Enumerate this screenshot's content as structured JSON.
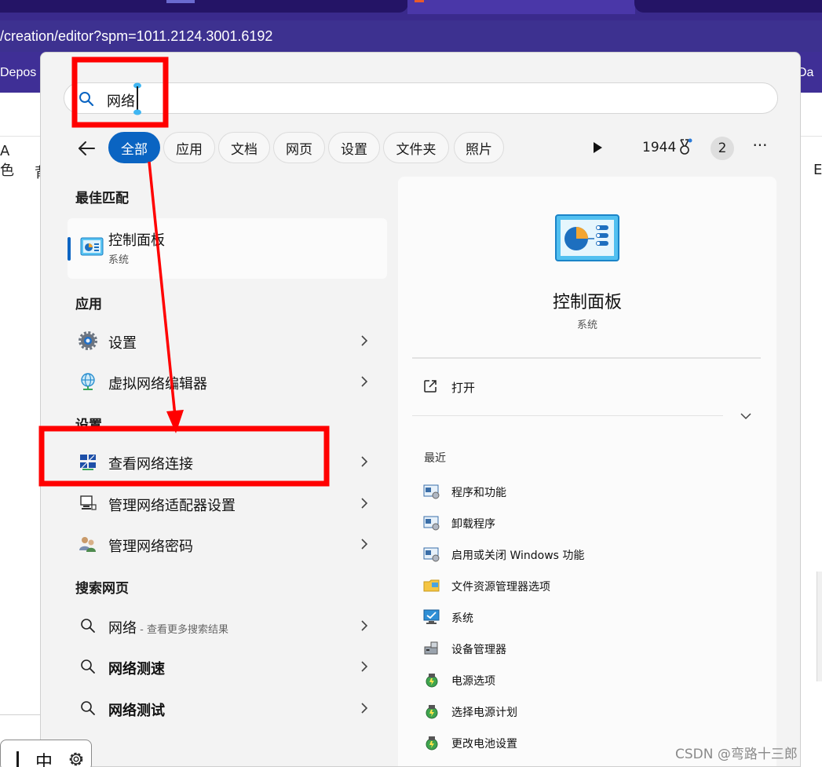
{
  "browser": {
    "url": "/creation/editor?spm=1011.2124.3001.6192",
    "bookmark_left": "Depos",
    "bookmark_right": "Da",
    "left_chars_line1": "A",
    "left_chars_line2": "色",
    "left_char_2": "背",
    "right_char": "E"
  },
  "ime": {
    "mode": "中",
    "settings_icon": "gear-icon"
  },
  "search": {
    "value": "网络",
    "icon": "search-icon"
  },
  "filters": [
    {
      "label": "全部",
      "active": true
    },
    {
      "label": "应用"
    },
    {
      "label": "文档"
    },
    {
      "label": "网页"
    },
    {
      "label": "设置"
    },
    {
      "label": "文件夹"
    },
    {
      "label": "照片"
    }
  ],
  "toolbar": {
    "points": "1944",
    "avatar": "2",
    "more": "···"
  },
  "best_match": {
    "section": "最佳匹配",
    "name": "控制面板",
    "sub": "系统"
  },
  "apps": {
    "section": "应用",
    "items": [
      {
        "label": "设置"
      },
      {
        "label": "虚拟网络编辑器"
      }
    ]
  },
  "settings": {
    "section": "设置",
    "items": [
      {
        "label": "查看网络连接"
      },
      {
        "label": "管理网络适配器设置"
      },
      {
        "label": "管理网络密码"
      }
    ]
  },
  "web": {
    "section": "搜索网页",
    "items": [
      {
        "label": "网络",
        "sub": " - 查看更多搜索结果"
      },
      {
        "label": "网络测速"
      },
      {
        "label": "网络测试"
      }
    ]
  },
  "detail": {
    "title": "控制面板",
    "sub": "系统",
    "open_label": "打开",
    "recent_title": "最近",
    "recent": [
      {
        "label": "程序和功能"
      },
      {
        "label": "卸载程序"
      },
      {
        "label": "启用或关闭 Windows 功能"
      },
      {
        "label": "文件资源管理器选项"
      },
      {
        "label": "系统"
      },
      {
        "label": "设备管理器"
      },
      {
        "label": "电源选项"
      },
      {
        "label": "选择电源计划"
      },
      {
        "label": "更改电池设置"
      }
    ]
  },
  "watermark": "CSDN @弯路十三郎",
  "colors": {
    "accent": "#0a64c2",
    "annotation": "#ff0000",
    "browser": "#3d3190"
  }
}
